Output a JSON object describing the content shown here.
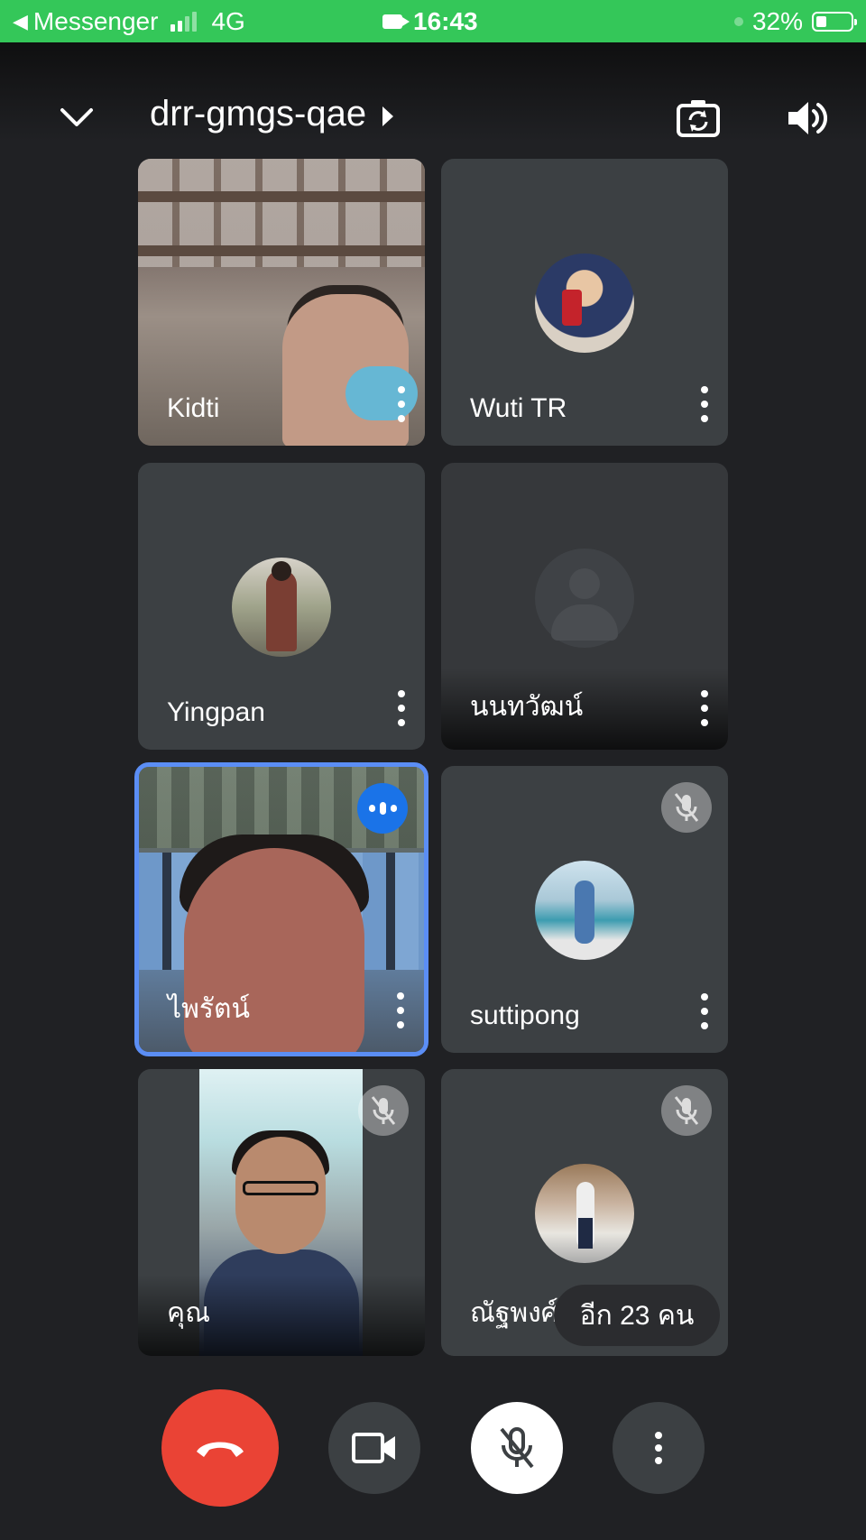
{
  "status_bar": {
    "back_app": "Messenger",
    "network": "4G",
    "time": "16:43",
    "battery": "32%"
  },
  "header": {
    "meeting_code": "drr-gmgs-qae"
  },
  "participants": [
    {
      "name": "Kidti",
      "state": "video"
    },
    {
      "name": "Wuti TR",
      "state": "avatar"
    },
    {
      "name": "Yingpan",
      "state": "avatar"
    },
    {
      "name": "นนทวัฒน์",
      "state": "avatar-placeholder"
    },
    {
      "name": "ไพรัตน์",
      "state": "video-speaking"
    },
    {
      "name": "suttipong",
      "state": "avatar-muted"
    },
    {
      "name": "คุณ",
      "state": "self-video-muted"
    },
    {
      "name": "ณัฐพงศ์",
      "state": "avatar-muted"
    }
  ],
  "others_pill": "อีก 23 คน",
  "colors": {
    "background": "#202124",
    "status_bar": "#34c759",
    "tile": "#3c4043",
    "end_call": "#ea4335",
    "speaking": "#1a73e8",
    "active_border": "#5b8ef5"
  },
  "controls": [
    "end-call",
    "camera",
    "microphone-muted",
    "more-options"
  ]
}
